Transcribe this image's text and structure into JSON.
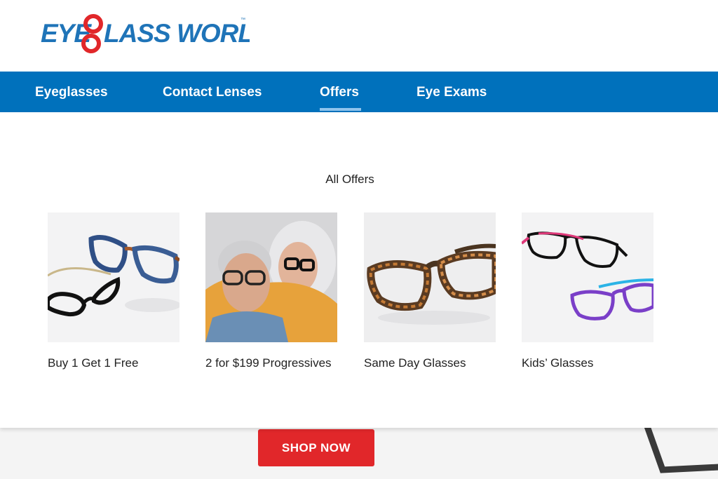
{
  "brand": {
    "logo_text": "EYEGLASS WORLD",
    "primary_color": "#0071bc",
    "logo_color": "#1f74b8",
    "accent_red": "#e1272a"
  },
  "nav": {
    "items": [
      {
        "label": "Eyeglasses"
      },
      {
        "label": "Contact Lenses"
      },
      {
        "label": "Offers",
        "active": true
      },
      {
        "label": "Eye Exams"
      }
    ]
  },
  "offers": {
    "title": "All Offers",
    "cards": [
      {
        "label": "Buy 1 Get 1 Free",
        "image": "glasses-pair-image"
      },
      {
        "label": "2 for $199 Progressives",
        "image": "couple-photo"
      },
      {
        "label": "Same Day Glasses",
        "image": "tortoise-glasses-image"
      },
      {
        "label": "Kids’ Glasses",
        "image": "kids-glasses-image"
      }
    ]
  },
  "cta": {
    "shop_now_label": "SHOP NOW"
  }
}
